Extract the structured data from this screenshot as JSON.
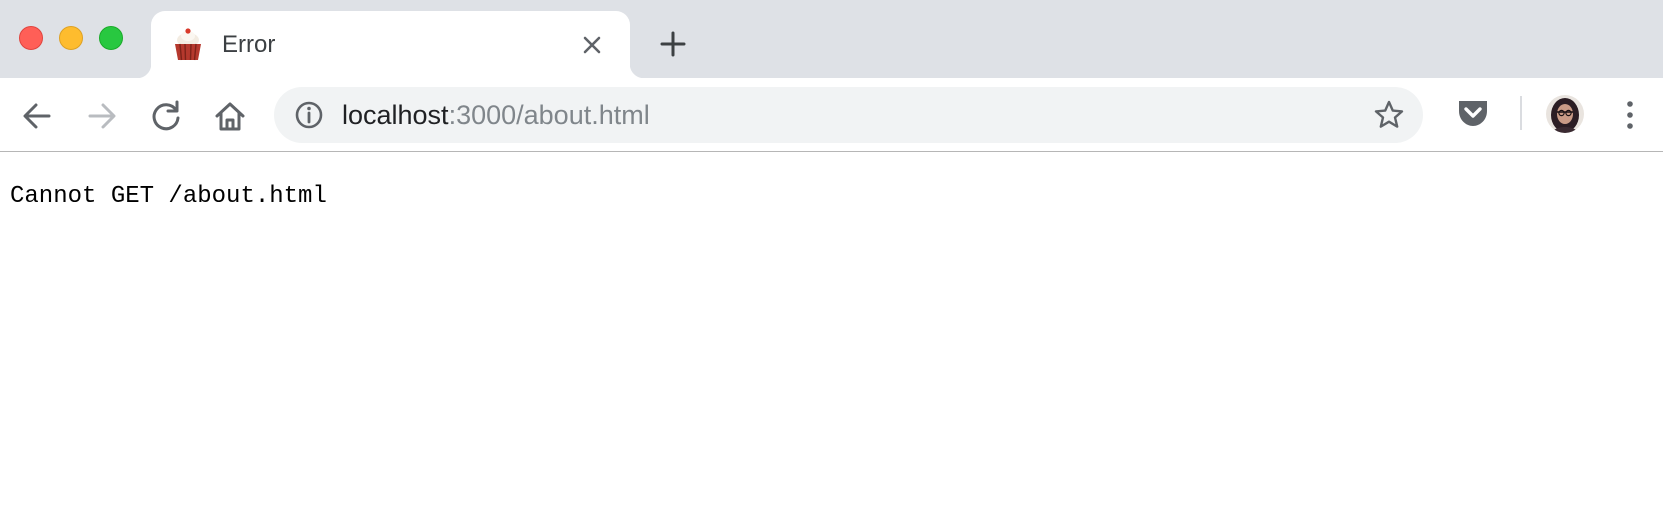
{
  "window": {
    "traffic_lights": [
      "close",
      "minimize",
      "maximize"
    ]
  },
  "tab": {
    "title": "Error",
    "favicon": "cupcake-icon",
    "close_icon": "close-icon"
  },
  "new_tab": {
    "icon": "plus-icon"
  },
  "toolbar": {
    "back_icon": "arrow-left-icon",
    "forward_icon": "arrow-right-icon",
    "reload_icon": "reload-icon",
    "home_icon": "home-icon",
    "bookmark_icon": "star-icon",
    "pocket_icon": "pocket-icon",
    "menu_icon": "three-dots-vertical-icon"
  },
  "address_bar": {
    "security_icon": "info-icon",
    "host": "localhost",
    "path": ":3000/about.html"
  },
  "page": {
    "message": "Cannot GET /about.html"
  },
  "colors": {
    "tabstrip_bg": "#dee1e6",
    "omnibox_bg": "#f1f3f4",
    "traffic_close": "#ff5f57",
    "traffic_minimize": "#febc2e",
    "traffic_maximize": "#28c840"
  }
}
